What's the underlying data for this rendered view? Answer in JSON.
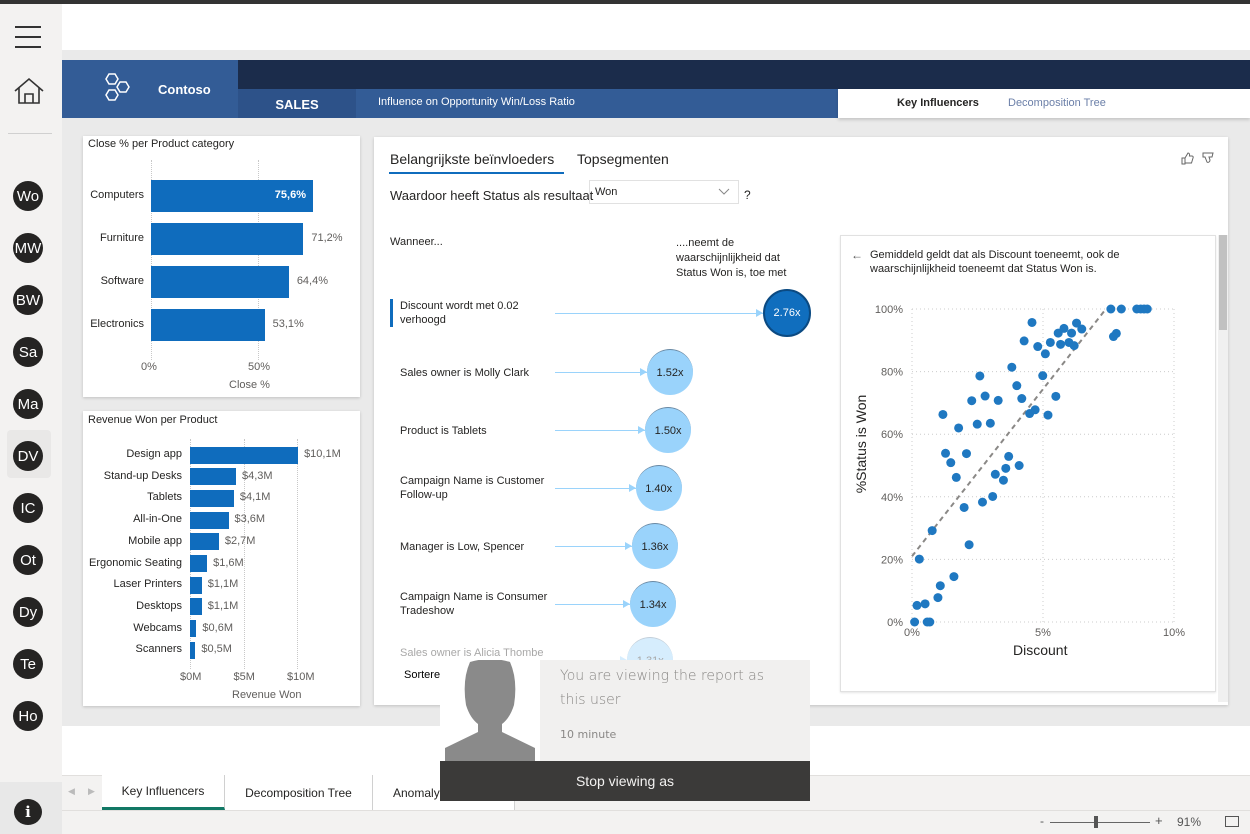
{
  "sidebar": {
    "menu_icon": "hamburger-icon",
    "home_icon": "home-icon",
    "workspaces": [
      "Wo",
      "MW",
      "BW",
      "Sa",
      "Ma",
      "DV",
      "IC",
      "Ot",
      "Dy",
      "Te",
      "Ho"
    ],
    "selected": "DV",
    "info_icon": "info-icon"
  },
  "header": {
    "brand": "Contoso",
    "logo_icon": "hexagons-logo-icon",
    "section": "SALES",
    "title": "Influence on Opportunity Win/Loss Ratio",
    "tabs": [
      {
        "label": "Key Influencers",
        "active": true
      },
      {
        "label": "Decomposition Tree",
        "active": false
      }
    ]
  },
  "colors": {
    "header_blue": "#335c96",
    "header_navy": "#1b2c4b",
    "bar_blue": "#0f6cbd",
    "bubble_dark": "#106ebe",
    "bubble_light": "#9ad3fb",
    "tab_active": "#117865"
  },
  "chart_data": [
    {
      "type": "bar",
      "title": "Close % per Product category",
      "categories": [
        "Computers",
        "Furniture",
        "Software",
        "Electronics"
      ],
      "values": [
        75.6,
        71.2,
        64.4,
        53.1
      ],
      "labels": [
        "75,6%",
        "71,2%",
        "64,4%",
        "53,1%"
      ],
      "xlabel": "Close %",
      "xticks": [
        "0%",
        "50%"
      ],
      "xlim": [
        0,
        100
      ],
      "grid": true
    },
    {
      "type": "bar",
      "title": "Revenue Won per Product",
      "categories": [
        "Design app",
        "Stand-up Desks",
        "Tablets",
        "All-in-One",
        "Mobile app",
        "Ergonomic Seating",
        "Laser Printers",
        "Desktops",
        "Webcams",
        "Scanners"
      ],
      "values": [
        10.1,
        4.3,
        4.1,
        3.6,
        2.7,
        1.6,
        1.1,
        1.1,
        0.6,
        0.5
      ],
      "labels": [
        "$10,1M",
        "$4,3M",
        "$4,1M",
        "$3,6M",
        "$2,7M",
        "$1,6M",
        "$1,1M",
        "$1,1M",
        "$0,6M",
        "$0,5M"
      ],
      "xlabel": "Revenue Won",
      "xticks": [
        "$0M",
        "$5M",
        "$10M"
      ],
      "xlim": [
        0,
        12
      ],
      "grid": true
    },
    {
      "type": "scatter",
      "xlabel": "Discount",
      "ylabel": "%Status is Won",
      "xticks": [
        "0%",
        "5%",
        "10%"
      ],
      "yticks": [
        "0%",
        "20%",
        "40%",
        "60%",
        "80%",
        "100%"
      ],
      "xlim": [
        0,
        10
      ],
      "ylim": [
        0,
        100
      ],
      "grid": true,
      "trendline": {
        "x": [
          0,
          7.4
        ],
        "y": [
          21,
          100
        ]
      },
      "points": [
        [
          0.1,
          0
        ],
        [
          0.19,
          5.3
        ],
        [
          0.5,
          5.8
        ],
        [
          0.58,
          0
        ],
        [
          0.68,
          0
        ],
        [
          0.99,
          7.8
        ],
        [
          1.08,
          11.6
        ],
        [
          1.6,
          14.5
        ],
        [
          0.28,
          20.1
        ],
        [
          0.77,
          29.2
        ],
        [
          2.18,
          24.7
        ],
        [
          1.99,
          36.6
        ],
        [
          2.69,
          38.3
        ],
        [
          3.08,
          40.1
        ],
        [
          1.69,
          46.2
        ],
        [
          1.48,
          50.9
        ],
        [
          1.28,
          53.9
        ],
        [
          2.08,
          53.8
        ],
        [
          3.18,
          47.2
        ],
        [
          3.49,
          45.3
        ],
        [
          3.58,
          49.1
        ],
        [
          3.69,
          52.9
        ],
        [
          4.09,
          50
        ],
        [
          1.18,
          66.3
        ],
        [
          1.78,
          62
        ],
        [
          2.49,
          63.2
        ],
        [
          2.99,
          63.5
        ],
        [
          2.28,
          70.7
        ],
        [
          2.79,
          72.2
        ],
        [
          3.29,
          70.8
        ],
        [
          2.59,
          78.6
        ],
        [
          3.81,
          81.4
        ],
        [
          4.0,
          75.5
        ],
        [
          4.19,
          71.4
        ],
        [
          4.49,
          66.6
        ],
        [
          4.7,
          67.8
        ],
        [
          4.99,
          78.7
        ],
        [
          5.19,
          66.1
        ],
        [
          5.49,
          72.1
        ],
        [
          4.28,
          89.8
        ],
        [
          4.58,
          95.7
        ],
        [
          4.8,
          88
        ],
        [
          5.09,
          85.7
        ],
        [
          5.28,
          89.3
        ],
        [
          5.58,
          92.3
        ],
        [
          5.67,
          88.7
        ],
        [
          5.8,
          93.8
        ],
        [
          5.99,
          89.3
        ],
        [
          6.09,
          92.3
        ],
        [
          6.19,
          88.3
        ],
        [
          6.28,
          95.5
        ],
        [
          6.48,
          93.6
        ],
        [
          7.59,
          100
        ],
        [
          7.99,
          100
        ],
        [
          7.69,
          91.2
        ],
        [
          7.8,
          92.2
        ],
        [
          8.58,
          100
        ],
        [
          8.73,
          100
        ],
        [
          8.86,
          100
        ],
        [
          8.98,
          100
        ]
      ]
    }
  ],
  "key_influencers": {
    "tabs": [
      {
        "label": "Belangrijkste beïnvloeders",
        "active": true
      },
      {
        "label": "Topsegmenten",
        "active": false
      }
    ],
    "question": "Waardoor heeft Status als resultaat",
    "dropdown_value": "Won",
    "help": "?",
    "col_when": "Wanneer...",
    "col_effect": "....neemt de waarschijnlijkheid dat Status Won is, toe met",
    "thumbs_up_icon": "thumbs-up-icon",
    "thumbs_down_icon": "thumbs-down-icon",
    "influencers": [
      {
        "label": "Discount wordt met 0.02 verhoogd",
        "value": 2.76,
        "text": "2.76x",
        "selected": true
      },
      {
        "label": "Sales owner is Molly Clark",
        "value": 1.52,
        "text": "1.52x"
      },
      {
        "label": "Product is Tablets",
        "value": 1.5,
        "text": "1.50x"
      },
      {
        "label": "Campaign Name is Customer Follow-up",
        "value": 1.4,
        "text": "1.40x"
      },
      {
        "label": "Manager is Low, Spencer",
        "value": 1.36,
        "text": "1.36x"
      },
      {
        "label": "Campaign Name is Consumer Tradeshow",
        "value": 1.34,
        "text": "1.34x"
      },
      {
        "label": "Sales owner is Alicia Thombe",
        "value": 1.31,
        "text": "1.31x"
      }
    ],
    "sort_label": "Sortere",
    "detail": {
      "back_icon": "arrow-left-icon",
      "text": "Gemiddeld geldt dat als Discount toeneemt, ook de waarschijnlijkheid toeneemt dat Status Won is."
    }
  },
  "bottom_tabs": [
    {
      "label": "Key Influencers",
      "active": true
    },
    {
      "label": "Decomposition Tree",
      "active": false
    },
    {
      "label": "Anomaly",
      "active": false
    }
  ],
  "popup": {
    "message": "You are viewing the report as this user",
    "time": "10 minute",
    "button": "Stop viewing as",
    "avatar_icon": "user-silhouette-icon"
  },
  "status": {
    "zoom": "91%",
    "zoom_level": 91,
    "minus": "-",
    "plus": "+",
    "fit_icon": "fit-to-page-icon"
  }
}
